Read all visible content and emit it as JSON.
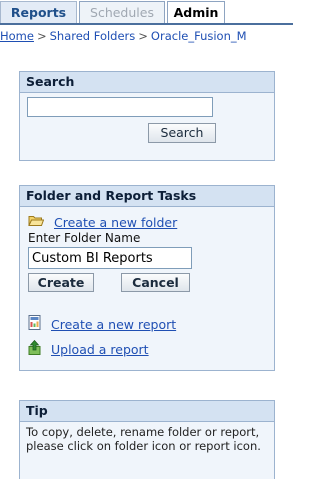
{
  "tabs": {
    "reports": "Reports",
    "schedules": "Schedules",
    "admin": "Admin"
  },
  "breadcrumb": {
    "home": "Home",
    "shared_folders": "Shared Folders",
    "current": "Oracle_Fusion_M",
    "separator": ">"
  },
  "search_panel": {
    "title": "Search",
    "input_value": "",
    "button_label": "Search"
  },
  "tasks_panel": {
    "title": "Folder and Report Tasks",
    "create_folder_link": "Create a new folder",
    "folder_name_label": "Enter Folder Name",
    "folder_name_value": "Custom BI Reports",
    "create_button": "Create",
    "cancel_button": "Cancel",
    "create_report_link": "Create a new report",
    "upload_report_link": "Upload a report"
  },
  "tip_panel": {
    "title": "Tip",
    "text": "To copy, delete, rename folder or report, please click on folder icon or report icon."
  },
  "icons": {
    "folder": "open-folder-icon",
    "report": "report-document-icon",
    "upload": "upload-arrow-icon"
  },
  "colors": {
    "link": "#1f4fb3",
    "panel_header_bg": "#d4e2f2",
    "panel_bg": "#f0f5fb",
    "panel_border": "#9cb3cf",
    "tab_line": "#4b6f9d"
  }
}
